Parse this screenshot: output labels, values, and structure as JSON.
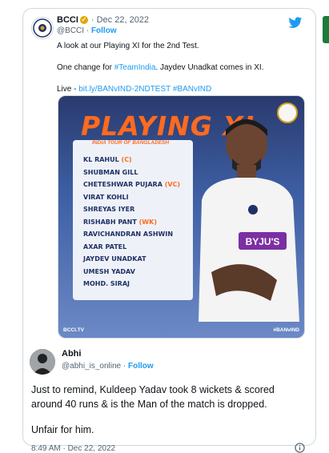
{
  "quoted": {
    "name": "BCCI",
    "date": "· Dec 22, 2022",
    "handle": "@BCCI",
    "follow": "Follow",
    "line1": "A look at our Playing XI for the 2nd Test.",
    "line2_pre": "One change for ",
    "line2_tag": "#TeamIndia",
    "line2_post": ". Jaydev Unadkat comes in XI.",
    "line3_pre": "Live - ",
    "line3_link": "bit.ly/BANvIND-2NDTEST #BANvIND"
  },
  "media": {
    "title": "PLAYING XI",
    "subtitle": "INDIA TOUR OF BANGLADESH",
    "players": [
      {
        "name": "KL RAHUL",
        "role": "(C)"
      },
      {
        "name": "SHUBMAN GILL",
        "role": ""
      },
      {
        "name": "CHETESHWAR PUJARA",
        "role": "(VC)"
      },
      {
        "name": "VIRAT KOHLI",
        "role": ""
      },
      {
        "name": "SHREYAS IYER",
        "role": ""
      },
      {
        "name": "RISHABH PANT",
        "role": "(WK)"
      },
      {
        "name": "RAVICHANDRAN ASHWIN",
        "role": ""
      },
      {
        "name": "AXAR PATEL",
        "role": ""
      },
      {
        "name": "JAYDEV UNADKAT",
        "role": ""
      },
      {
        "name": "UMESH YADAV",
        "role": ""
      },
      {
        "name": "MOHD. SIRAJ",
        "role": ""
      }
    ],
    "footer_left": "BCCI.TV",
    "footer_right": "#BANvIND",
    "jersey_text": "BYJU'S"
  },
  "reply": {
    "name": "Abhi",
    "handle": "@abhi_is_online",
    "follow": "Follow",
    "line1": "Just to remind, Kuldeep Yadav took 8 wickets & scored",
    "line2": "around 40 runs & is the Man of the match is dropped.",
    "line3": "Unfair for him.",
    "timestamp": "8:49 AM · Dec 22, 2022"
  },
  "colors": {
    "accent": "#1d9bf0",
    "brand_orange": "#ff6a1f",
    "text": "#0f1419",
    "muted": "#536471"
  },
  "icons": [
    "twitter-bird-icon",
    "verified-badge-icon",
    "info-icon",
    "bcci-crest-icon"
  ]
}
